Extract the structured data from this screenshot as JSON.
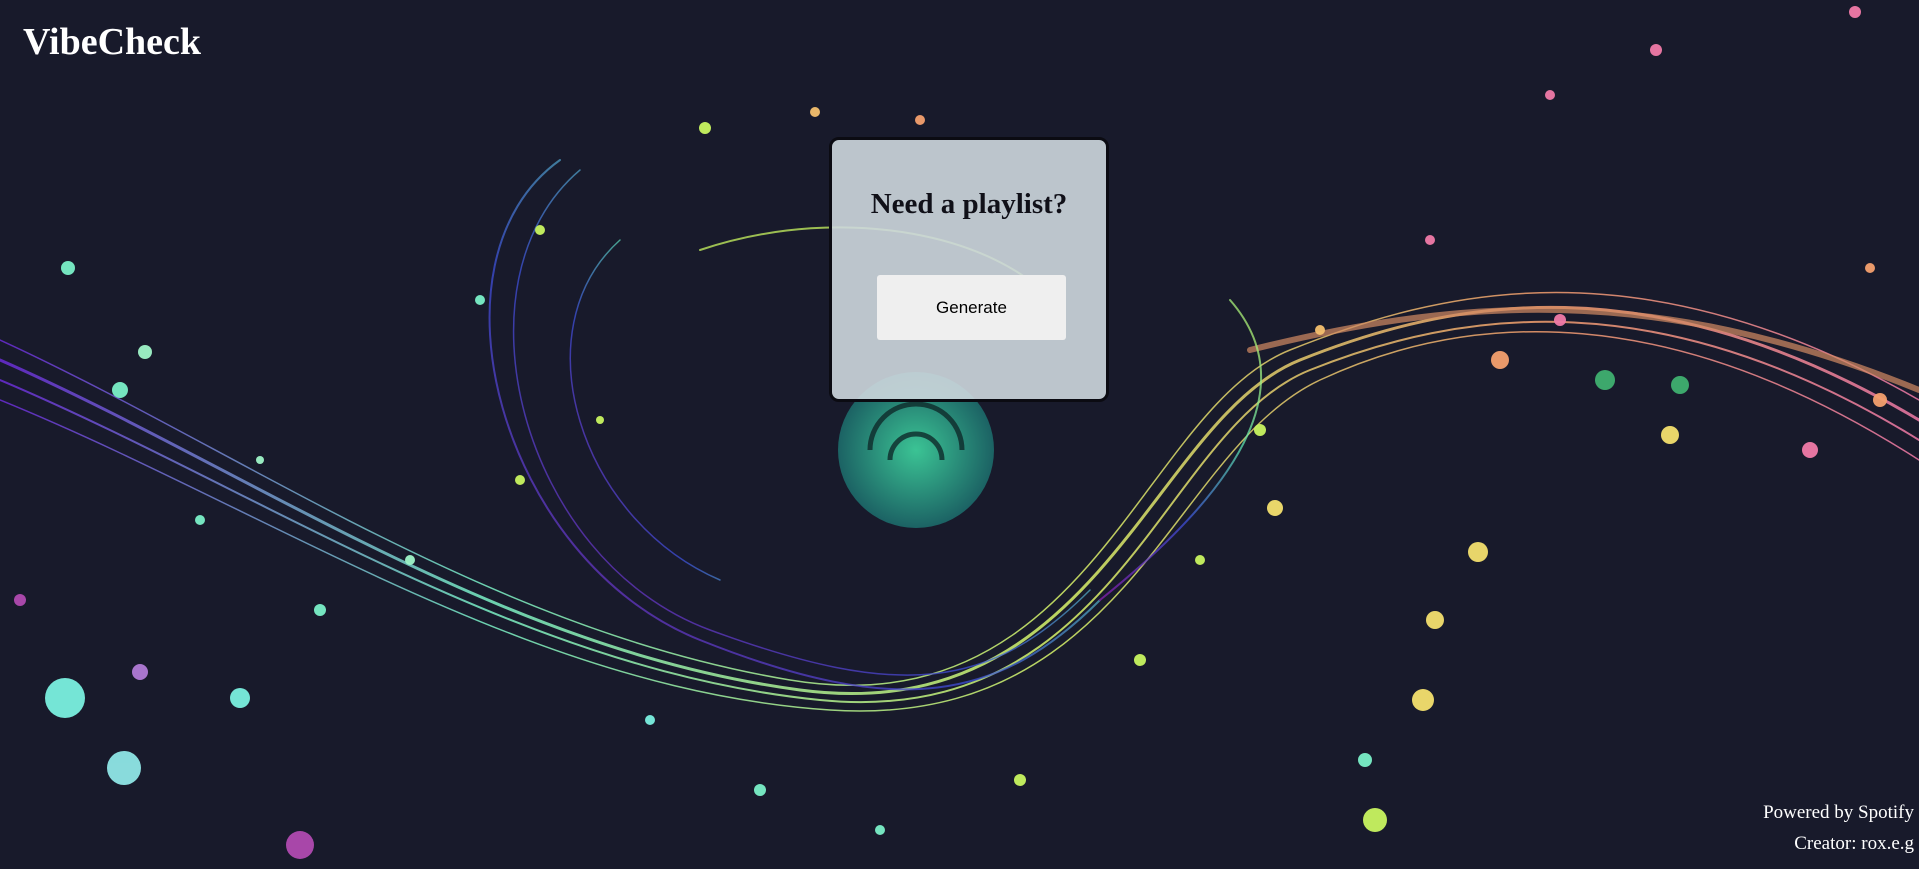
{
  "app": {
    "brand": "VibeCheck"
  },
  "card": {
    "title": "Need a playlist?",
    "generate_label": "Generate"
  },
  "footer": {
    "powered_by": "Powered by Spotify",
    "creator": "Creator: rox.e.g"
  },
  "colors": {
    "background": "#181a2b",
    "card_background": "#ced8de",
    "button_background": "#efefef"
  }
}
